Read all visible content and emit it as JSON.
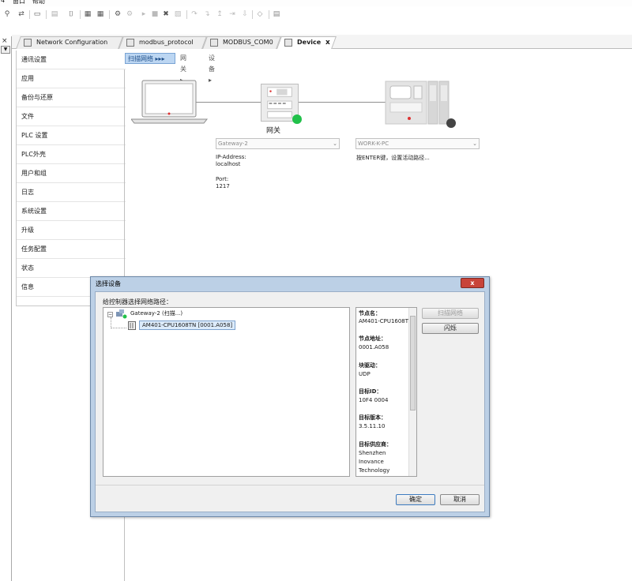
{
  "menubar": {
    "items": [
      "4",
      "窗口",
      "帮助"
    ]
  },
  "toolbar": {
    "icons": [
      "binoculars-icon",
      "find-replace-icon",
      "print-icon",
      "undo-icon",
      "new-object-icon",
      "build-icon",
      "rebuild-icon",
      "login-icon",
      "logout-icon",
      "run-icon",
      "stop-icon",
      "reset-icon",
      "clear-breakpoints-icon",
      "step-over-icon",
      "step-into-icon",
      "step-out-icon",
      "run-to-cursor-icon",
      "write-values-icon",
      "monitor-icon"
    ]
  },
  "tabs": [
    {
      "label": "Network Configuration"
    },
    {
      "label": "modbus_protocol"
    },
    {
      "label": "MODBUS_COM0"
    },
    {
      "label": "Device",
      "close": "x"
    }
  ],
  "sidenav": {
    "items": [
      "通讯设置",
      "应用",
      "备份与还原",
      "文件",
      "PLC 设置",
      "PLC外壳",
      "用户和组",
      "日志",
      "系统设置",
      "升级",
      "任务配置",
      "状态",
      "信息"
    ],
    "selected_index": 0
  },
  "breadcrumb": [
    "扫描网络",
    "网关",
    "设备"
  ],
  "diagram": {
    "gateway_label": "网关",
    "gateway_combo": "Gateway-2",
    "ip_label": "IP-Address:",
    "ip_value": "localhost",
    "port_label": "Port:",
    "port_value": "1217",
    "device_combo": "WORK-K-PC",
    "device_hint": "按ENTER键，设置活动路径...",
    "gateway_status_color": "#21c14a",
    "device_status_color": "#444444"
  },
  "dialog": {
    "title": "选择设备",
    "close": "x",
    "instruction": "给控制器选择网络路径：",
    "tree": {
      "gateway": "Gateway-2 (扫描...)",
      "device": "AM401-CPU1608TN [0001.A058]"
    },
    "info": [
      {
        "label": "节点名：",
        "value": "AM401-CPU1608TN"
      },
      {
        "label": "节点地址：",
        "value": "0001.A058"
      },
      {
        "label": "块驱动：",
        "value": "UDP"
      },
      {
        "label": "目标ID：",
        "value": "10F4 0004"
      },
      {
        "label": "目标版本：",
        "value": "3.5.11.10"
      },
      {
        "label": "目标供应商：",
        "value": "Shenzhen Inovance Technology"
      }
    ],
    "buttons": {
      "scan": "扫描网络",
      "wink": "闪烁",
      "ok": "确定",
      "cancel": "取消"
    }
  }
}
